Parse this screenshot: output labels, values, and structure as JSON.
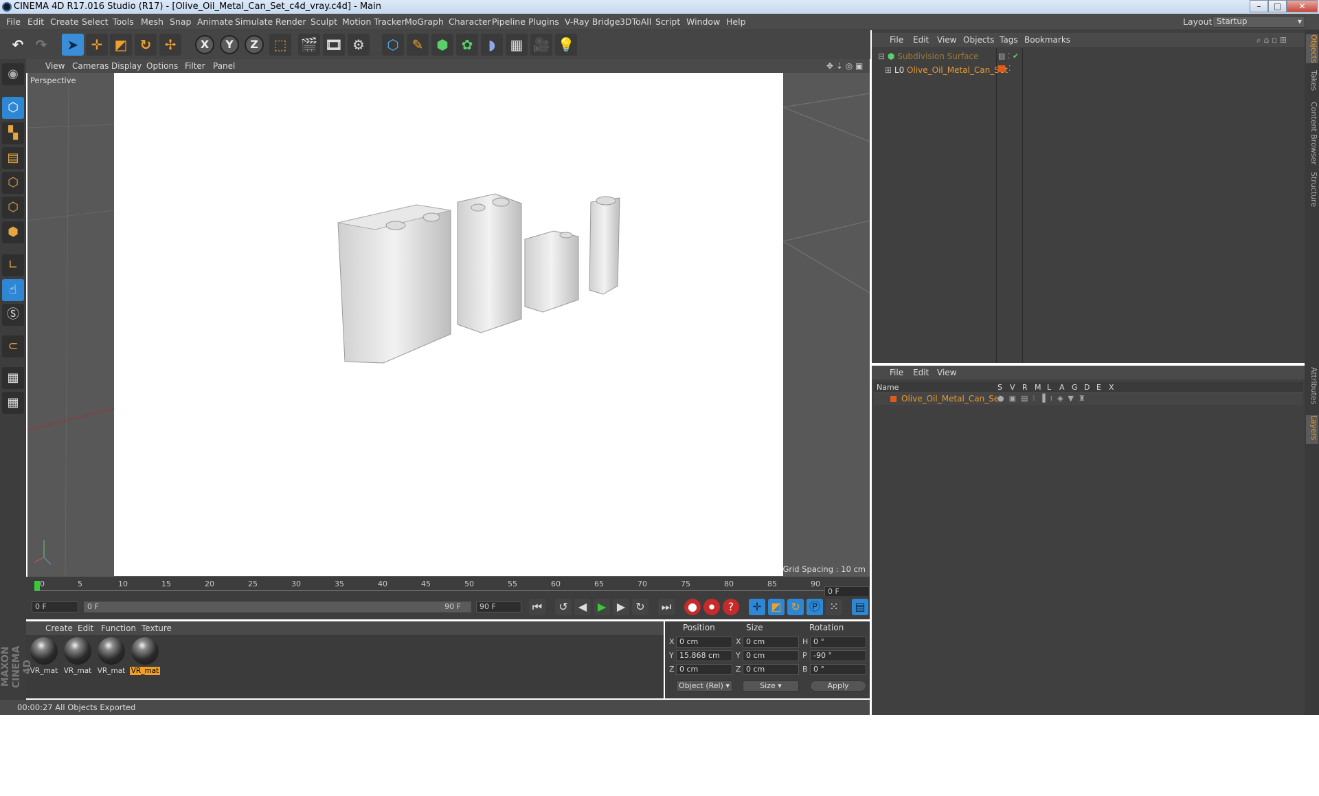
{
  "window": {
    "title": "CINEMA 4D R17.016 Studio (R17) - [Olive_Oil_Metal_Can_Set_c4d_vray.c4d] - Main",
    "minimize": "–",
    "maximize": "□",
    "close": "✕"
  },
  "menubar": {
    "items": [
      "File",
      "Edit",
      "Create",
      "Select",
      "Tools",
      "Mesh",
      "Snap",
      "Animate",
      "Simulate",
      "Render",
      "Sculpt",
      "Motion Tracker",
      "MoGraph",
      "Character",
      "Pipeline",
      "Plugins",
      "V-Ray Bridge",
      "3DToAll",
      "Script",
      "Window",
      "Help"
    ],
    "layout_label": "Layout:",
    "layout_value": "Startup"
  },
  "toolbar": {
    "axis_x": "X",
    "axis_y": "Y",
    "axis_z": "Z"
  },
  "viewport": {
    "menu": [
      "View",
      "Cameras",
      "Display",
      "Options",
      "Filter",
      "Panel"
    ],
    "camera_label": "Perspective",
    "grid_spacing": "Grid Spacing : 10 cm"
  },
  "timeline": {
    "ticks": [
      "0",
      "5",
      "10",
      "15",
      "20",
      "25",
      "30",
      "35",
      "40",
      "45",
      "50",
      "55",
      "60",
      "65",
      "70",
      "75",
      "80",
      "85",
      "90"
    ],
    "current_frame": "0 F",
    "start_field": "0 F",
    "range_start": "0 F",
    "range_end": "90 F",
    "end_field": "90 F"
  },
  "materials": {
    "menu": [
      "Create",
      "Edit",
      "Function",
      "Texture"
    ],
    "items": [
      {
        "label": "VR_mat",
        "selected": false
      },
      {
        "label": "VR_mat",
        "selected": false
      },
      {
        "label": "VR_mat",
        "selected": false
      },
      {
        "label": "VR_mat",
        "selected": true
      }
    ]
  },
  "coordinates": {
    "headers": {
      "position": "Position",
      "size": "Size",
      "rotation": "Rotation"
    },
    "position": {
      "x": "0 cm",
      "y": "15.868 cm",
      "z": "0 cm"
    },
    "size": {
      "x": "0 cm",
      "y": "0 cm",
      "z": "0 cm"
    },
    "rotation": {
      "h": "0 °",
      "p": "-90 °",
      "b": "0 °"
    },
    "axis_labels": {
      "x": "X",
      "y": "Y",
      "z": "Z",
      "h": "H",
      "p": "P",
      "b": "B"
    },
    "mode_select": "Object (Rel)",
    "size_select": "Size",
    "apply": "Apply"
  },
  "status": {
    "text": "00:00:27 All Objects Exported"
  },
  "objects_panel": {
    "menu": [
      "File",
      "Edit",
      "View",
      "Objects",
      "Tags",
      "Bookmarks"
    ],
    "rows": [
      {
        "name": "Subdivision Surface"
      },
      {
        "name": "Olive_Oil_Metal_Can_Set"
      }
    ]
  },
  "layers_panel": {
    "menu": [
      "File",
      "Edit",
      "View"
    ],
    "columns": [
      "Name",
      "S",
      "V",
      "R",
      "M",
      "L",
      "A",
      "G",
      "D",
      "E",
      "X"
    ],
    "rows": [
      {
        "name": "Olive_Oil_Metal_Can_Set"
      }
    ]
  },
  "side_tabs": [
    "Objects",
    "Takes",
    "Content Browser",
    "Structure",
    "Attributes",
    "Layers"
  ],
  "brand": "MAXON CINEMA 4D",
  "colors": {
    "accent_orange": "#e59a2e",
    "active_blue": "#2d87d4",
    "ui_dark": "#404040"
  }
}
